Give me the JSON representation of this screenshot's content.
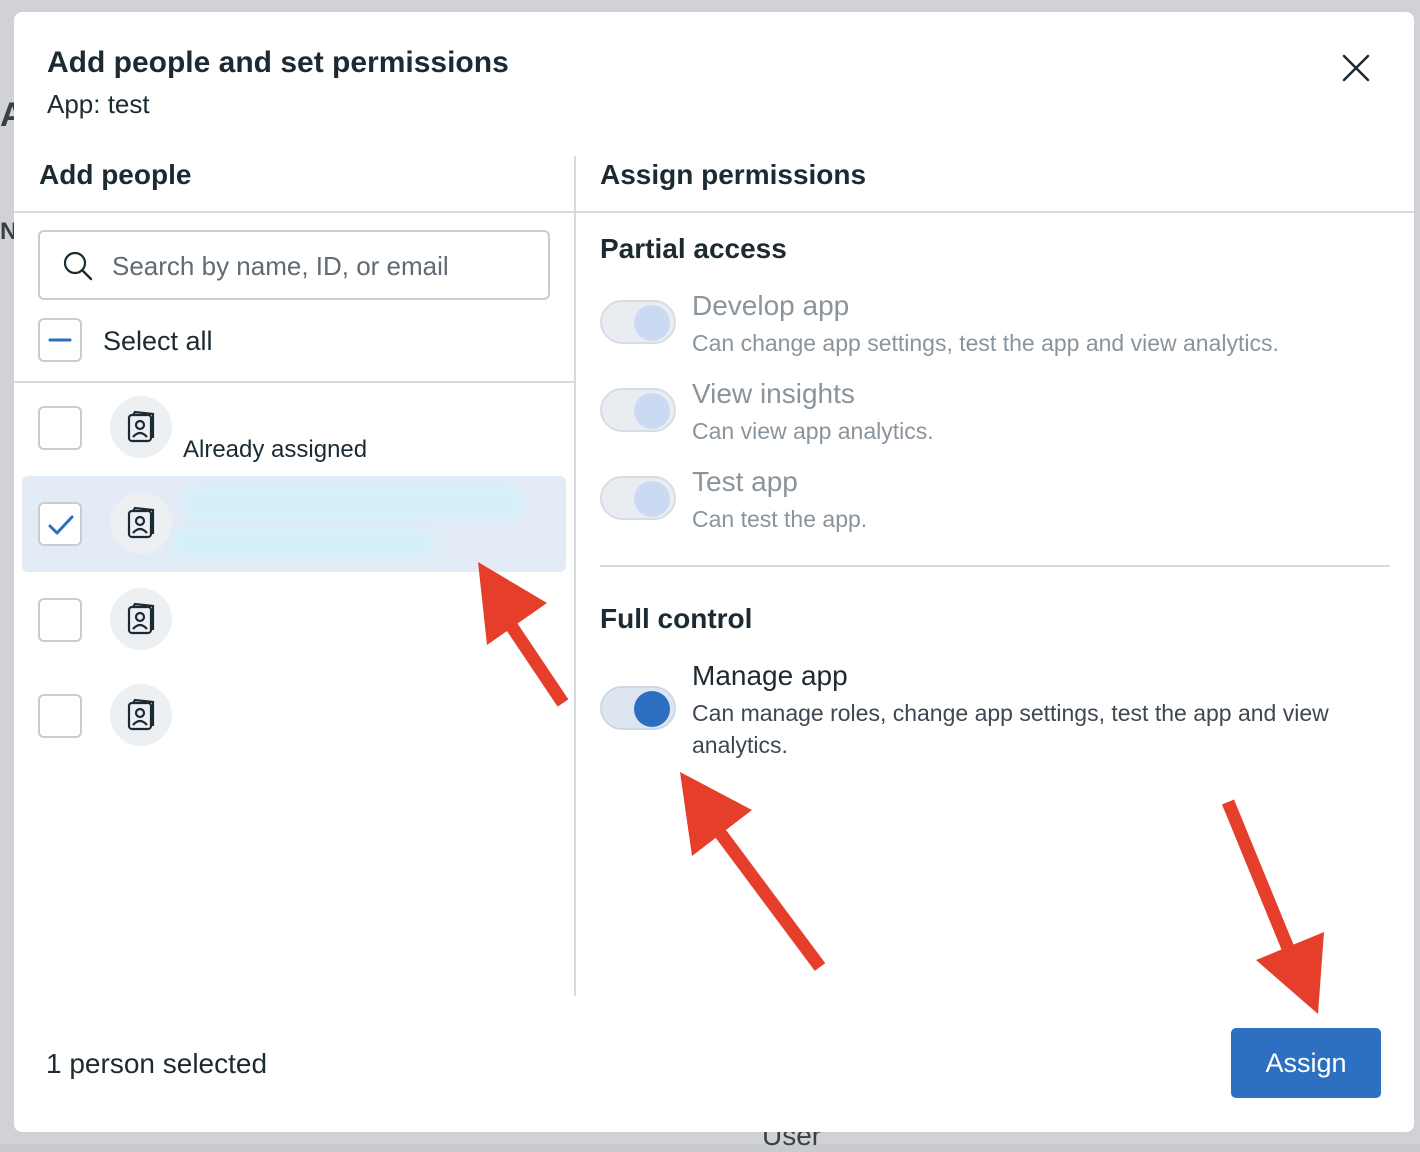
{
  "background": {
    "letters": [
      "A",
      "N"
    ],
    "user_text": "User"
  },
  "dialog": {
    "title": "Add people and set permissions",
    "subtitle": "App: test",
    "close_icon": "close-icon"
  },
  "people": {
    "heading": "Add people",
    "search_placeholder": "Search by name, ID, or email",
    "select_all_label": "Select all",
    "rows": [
      {
        "checked": false,
        "note": "Already assigned"
      },
      {
        "checked": true,
        "note": ""
      },
      {
        "checked": false,
        "note": ""
      },
      {
        "checked": false,
        "note": ""
      }
    ]
  },
  "permissions": {
    "heading": "Assign permissions",
    "partial": {
      "title": "Partial access",
      "items": [
        {
          "name": "Develop app",
          "desc": "Can change app settings, test the app and view analytics.",
          "on": false
        },
        {
          "name": "View insights",
          "desc": "Can view app analytics.",
          "on": false
        },
        {
          "name": "Test app",
          "desc": "Can test the app.",
          "on": false
        }
      ]
    },
    "full": {
      "title": "Full control",
      "items": [
        {
          "name": "Manage app",
          "desc": "Can manage roles, change app settings, test the app and view analytics.",
          "on": true
        }
      ]
    }
  },
  "footer": {
    "selected_text": "1 person selected",
    "assign_label": "Assign"
  },
  "colors": {
    "accent": "#2d70c1",
    "annotation_arrow": "#e53e2a"
  }
}
